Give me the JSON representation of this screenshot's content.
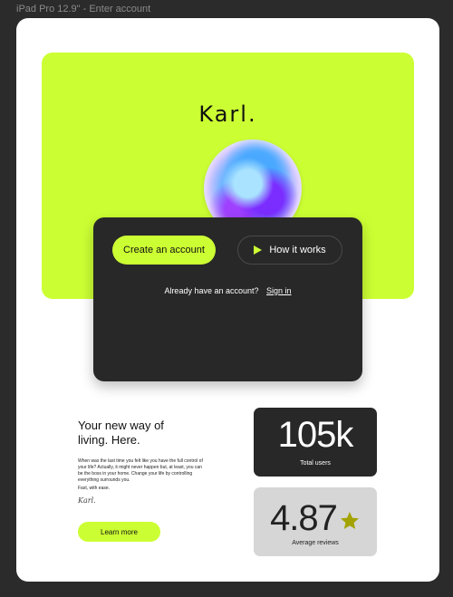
{
  "window": {
    "title": "iPad Pro 12.9\" - Enter account"
  },
  "hero": {
    "brand": "Karl.",
    "image_icon": "gradient-orb",
    "accent_color": "#ccff33"
  },
  "card": {
    "create_account_label": "Create an account",
    "how_it_works_label": "How it works",
    "how_it_works_icon": "play-icon",
    "signin_prompt": "Already have an account?",
    "signin_link": "Sign in"
  },
  "about": {
    "title": "Your new way of living. Here.",
    "body": "When was the last time you felt like you have the full control of your life? Actually, it might never happen but, at least, you can be the boss in your home. Change your life by controlling everything surrounds you.",
    "tagline": "Fast, with ease.",
    "signature": "Karl.",
    "learn_more_label": "Learn more"
  },
  "stats": [
    {
      "value": "105k",
      "label": "Total users"
    },
    {
      "value": "4.87",
      "label": "Average reviews",
      "icon": "star-icon",
      "icon_color": "#a3a300"
    }
  ]
}
